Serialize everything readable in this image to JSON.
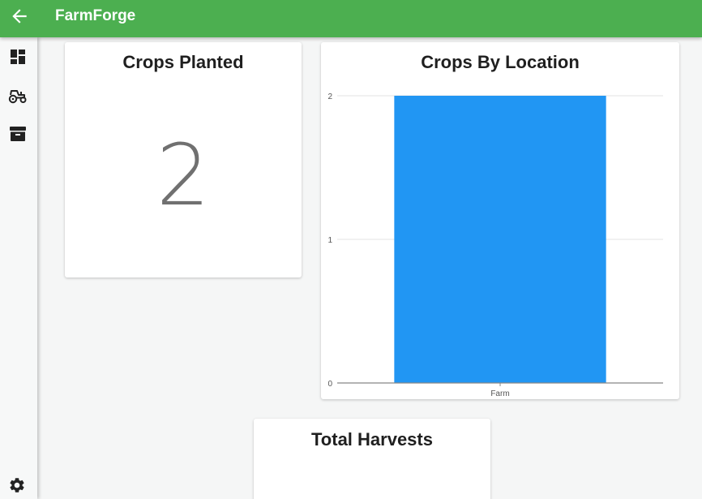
{
  "appbar": {
    "title": "FarmForge",
    "back_icon": "arrow-left-icon",
    "color": "#4caf50"
  },
  "sidebar": {
    "items": [
      {
        "name": "dashboard",
        "icon": "dashboard-icon"
      },
      {
        "name": "equipment",
        "icon": "tractor-icon"
      },
      {
        "name": "inventory",
        "icon": "archive-icon"
      }
    ],
    "footer": {
      "name": "settings",
      "icon": "gear-icon"
    }
  },
  "cards": {
    "crops_planted": {
      "title": "Crops Planted",
      "value": "2"
    },
    "crops_by_location": {
      "title": "Crops By Location"
    },
    "total_harvests": {
      "title": "Total Harvests"
    }
  },
  "chart_data": {
    "type": "bar",
    "title": "Crops By Location",
    "categories": [
      "Farm"
    ],
    "values": [
      2
    ],
    "ylim": [
      0,
      2
    ],
    "yticks": [
      "0",
      "1",
      "2"
    ],
    "grid": true,
    "bar_color": "#2196f3"
  }
}
